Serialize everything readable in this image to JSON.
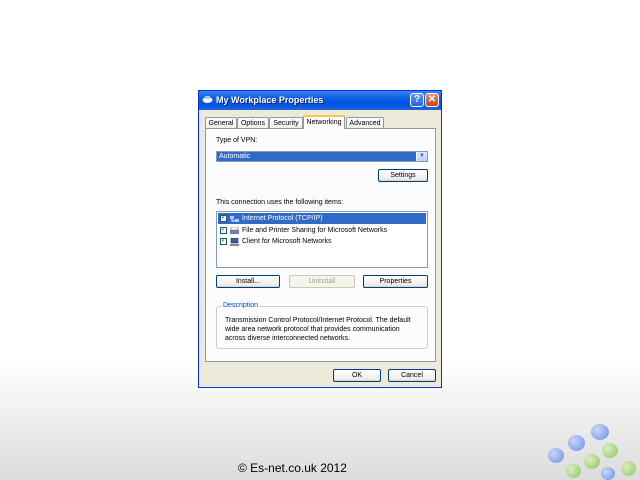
{
  "window": {
    "title": "My Workplace Properties",
    "help_glyph": "?",
    "close_glyph": "✕"
  },
  "tabs": [
    {
      "label": "General",
      "active": false
    },
    {
      "label": "Options",
      "active": false
    },
    {
      "label": "Security",
      "active": false
    },
    {
      "label": "Networking",
      "active": true
    },
    {
      "label": "Advanced",
      "active": false
    }
  ],
  "vpn": {
    "label": "Type of VPN:",
    "selected": "Automatic",
    "settings_label": "Settings"
  },
  "components": {
    "label": "This connection uses the following items:",
    "items": [
      {
        "label": "Internet Protocol (TCP/IP)",
        "checked": true,
        "selected": true,
        "icon": "protocol-icon"
      },
      {
        "label": "File and Printer Sharing for Microsoft Networks",
        "checked": true,
        "selected": false,
        "icon": "printer-sharing-icon"
      },
      {
        "label": "Client for Microsoft Networks",
        "checked": true,
        "selected": false,
        "icon": "network-client-icon"
      }
    ],
    "install_label": "Install...",
    "uninstall_label": "Uninstall",
    "properties_label": "Properties"
  },
  "description": {
    "title": "Description",
    "text": "Transmission Control Protocol/Internet Protocol. The default wide area network protocol that provides communication across diverse interconnected networks."
  },
  "buttons": {
    "ok_label": "OK",
    "cancel_label": "Cancel"
  },
  "footer": {
    "copyright": "© Es-net.co.uk 2012"
  },
  "colors": {
    "title_bar": "#0054e3",
    "selection": "#316ac5",
    "dialog_bg": "#ece9d8",
    "group_title": "#0046d5"
  }
}
